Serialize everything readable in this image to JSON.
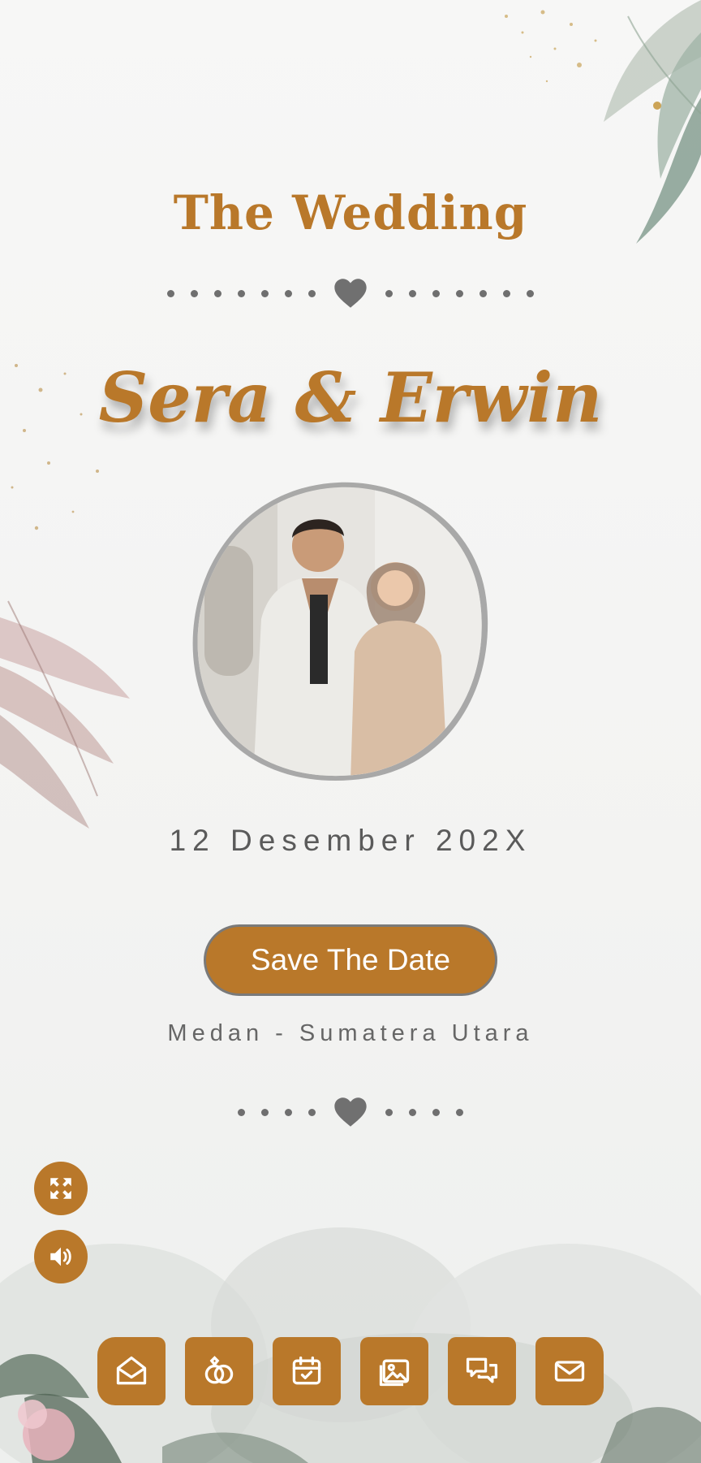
{
  "header": {
    "title": "The Wedding",
    "couple_names": "Sera & Erwin"
  },
  "event": {
    "date": "12 Desember 202X",
    "save_button_label": "Save The Date",
    "location": "Medan - Sumatera Utara"
  },
  "floating_controls": [
    {
      "icon": "expand-icon"
    },
    {
      "icon": "speaker-icon"
    }
  ],
  "bottom_nav": [
    {
      "icon": "envelope-open-icon"
    },
    {
      "icon": "rings-icon"
    },
    {
      "icon": "calendar-check-icon"
    },
    {
      "icon": "gallery-icon"
    },
    {
      "icon": "chat-icon"
    },
    {
      "icon": "mail-icon"
    }
  ],
  "colors": {
    "accent": "#b9782a",
    "text_gray": "#5a5a5a",
    "background": "#f6f6f5"
  }
}
